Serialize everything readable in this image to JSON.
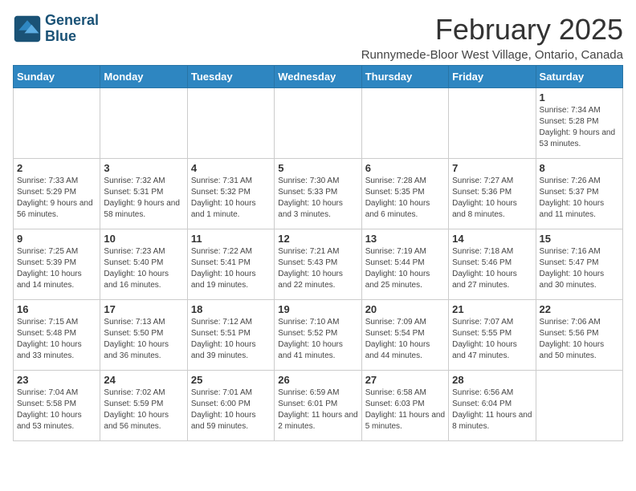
{
  "header": {
    "logo_line1": "General",
    "logo_line2": "Blue",
    "month_title": "February 2025",
    "location": "Runnymede-Bloor West Village, Ontario, Canada"
  },
  "weekdays": [
    "Sunday",
    "Monday",
    "Tuesday",
    "Wednesday",
    "Thursday",
    "Friday",
    "Saturday"
  ],
  "weeks": [
    [
      {
        "day": "",
        "info": ""
      },
      {
        "day": "",
        "info": ""
      },
      {
        "day": "",
        "info": ""
      },
      {
        "day": "",
        "info": ""
      },
      {
        "day": "",
        "info": ""
      },
      {
        "day": "",
        "info": ""
      },
      {
        "day": "1",
        "info": "Sunrise: 7:34 AM\nSunset: 5:28 PM\nDaylight: 9 hours and 53 minutes."
      }
    ],
    [
      {
        "day": "2",
        "info": "Sunrise: 7:33 AM\nSunset: 5:29 PM\nDaylight: 9 hours and 56 minutes."
      },
      {
        "day": "3",
        "info": "Sunrise: 7:32 AM\nSunset: 5:31 PM\nDaylight: 9 hours and 58 minutes."
      },
      {
        "day": "4",
        "info": "Sunrise: 7:31 AM\nSunset: 5:32 PM\nDaylight: 10 hours and 1 minute."
      },
      {
        "day": "5",
        "info": "Sunrise: 7:30 AM\nSunset: 5:33 PM\nDaylight: 10 hours and 3 minutes."
      },
      {
        "day": "6",
        "info": "Sunrise: 7:28 AM\nSunset: 5:35 PM\nDaylight: 10 hours and 6 minutes."
      },
      {
        "day": "7",
        "info": "Sunrise: 7:27 AM\nSunset: 5:36 PM\nDaylight: 10 hours and 8 minutes."
      },
      {
        "day": "8",
        "info": "Sunrise: 7:26 AM\nSunset: 5:37 PM\nDaylight: 10 hours and 11 minutes."
      }
    ],
    [
      {
        "day": "9",
        "info": "Sunrise: 7:25 AM\nSunset: 5:39 PM\nDaylight: 10 hours and 14 minutes."
      },
      {
        "day": "10",
        "info": "Sunrise: 7:23 AM\nSunset: 5:40 PM\nDaylight: 10 hours and 16 minutes."
      },
      {
        "day": "11",
        "info": "Sunrise: 7:22 AM\nSunset: 5:41 PM\nDaylight: 10 hours and 19 minutes."
      },
      {
        "day": "12",
        "info": "Sunrise: 7:21 AM\nSunset: 5:43 PM\nDaylight: 10 hours and 22 minutes."
      },
      {
        "day": "13",
        "info": "Sunrise: 7:19 AM\nSunset: 5:44 PM\nDaylight: 10 hours and 25 minutes."
      },
      {
        "day": "14",
        "info": "Sunrise: 7:18 AM\nSunset: 5:46 PM\nDaylight: 10 hours and 27 minutes."
      },
      {
        "day": "15",
        "info": "Sunrise: 7:16 AM\nSunset: 5:47 PM\nDaylight: 10 hours and 30 minutes."
      }
    ],
    [
      {
        "day": "16",
        "info": "Sunrise: 7:15 AM\nSunset: 5:48 PM\nDaylight: 10 hours and 33 minutes."
      },
      {
        "day": "17",
        "info": "Sunrise: 7:13 AM\nSunset: 5:50 PM\nDaylight: 10 hours and 36 minutes."
      },
      {
        "day": "18",
        "info": "Sunrise: 7:12 AM\nSunset: 5:51 PM\nDaylight: 10 hours and 39 minutes."
      },
      {
        "day": "19",
        "info": "Sunrise: 7:10 AM\nSunset: 5:52 PM\nDaylight: 10 hours and 41 minutes."
      },
      {
        "day": "20",
        "info": "Sunrise: 7:09 AM\nSunset: 5:54 PM\nDaylight: 10 hours and 44 minutes."
      },
      {
        "day": "21",
        "info": "Sunrise: 7:07 AM\nSunset: 5:55 PM\nDaylight: 10 hours and 47 minutes."
      },
      {
        "day": "22",
        "info": "Sunrise: 7:06 AM\nSunset: 5:56 PM\nDaylight: 10 hours and 50 minutes."
      }
    ],
    [
      {
        "day": "23",
        "info": "Sunrise: 7:04 AM\nSunset: 5:58 PM\nDaylight: 10 hours and 53 minutes."
      },
      {
        "day": "24",
        "info": "Sunrise: 7:02 AM\nSunset: 5:59 PM\nDaylight: 10 hours and 56 minutes."
      },
      {
        "day": "25",
        "info": "Sunrise: 7:01 AM\nSunset: 6:00 PM\nDaylight: 10 hours and 59 minutes."
      },
      {
        "day": "26",
        "info": "Sunrise: 6:59 AM\nSunset: 6:01 PM\nDaylight: 11 hours and 2 minutes."
      },
      {
        "day": "27",
        "info": "Sunrise: 6:58 AM\nSunset: 6:03 PM\nDaylight: 11 hours and 5 minutes."
      },
      {
        "day": "28",
        "info": "Sunrise: 6:56 AM\nSunset: 6:04 PM\nDaylight: 11 hours and 8 minutes."
      },
      {
        "day": "",
        "info": ""
      }
    ]
  ]
}
